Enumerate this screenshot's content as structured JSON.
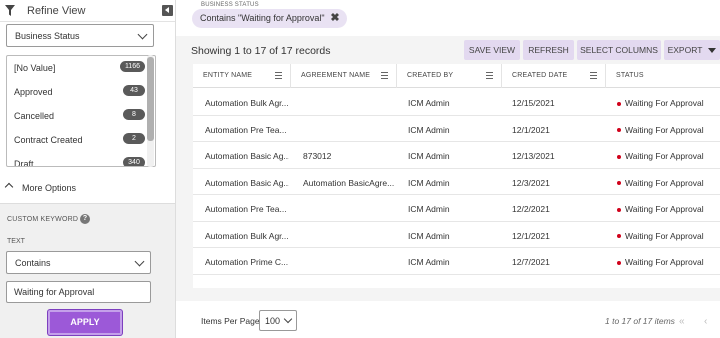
{
  "sidebar": {
    "title": "Refine View",
    "field_select": "Business Status",
    "filter_items": [
      {
        "label": "[No Value]",
        "count": "1166"
      },
      {
        "label": "Approved",
        "count": "43"
      },
      {
        "label": "Cancelled",
        "count": "8"
      },
      {
        "label": "Contract Created",
        "count": "2"
      },
      {
        "label": "Draft",
        "count": "340"
      }
    ],
    "more_options": "More Options",
    "custom_keyword": "CUSTOM KEYWORD",
    "text_label": "TEXT",
    "operator": "Contains",
    "keyword_value": "Waiting for Approval",
    "apply": "APPLY"
  },
  "chip": {
    "caption": "BUSINESS STATUS",
    "label": "Contains \"Waiting for Approval\"",
    "close_glyph": "✖"
  },
  "toolbar": {
    "showing": "Showing 1 to 17 of 17 records",
    "save_view": "SAVE VIEW",
    "refresh": "REFRESH",
    "select_columns": "SELECT COLUMNS",
    "export": "EXPORT"
  },
  "table": {
    "columns": [
      "ENTITY NAME",
      "AGREEMENT NAME",
      "CREATED BY",
      "CREATED DATE",
      "STATUS"
    ],
    "rows": [
      [
        "Automation Bulk Agr...",
        "",
        "ICM Admin",
        "12/15/2021",
        "Waiting For Approval"
      ],
      [
        "Automation Pre Tea...",
        "",
        "ICM Admin",
        "12/1/2021",
        "Waiting For Approval"
      ],
      [
        "Automation Basic Ag...",
        "873012",
        "ICM Admin",
        "12/13/2021",
        "Waiting For Approval"
      ],
      [
        "Automation Basic Ag...",
        "Automation BasicAgre...",
        "ICM Admin",
        "12/3/2021",
        "Waiting For Approval"
      ],
      [
        "Automation Pre Tea...",
        "",
        "ICM Admin",
        "12/2/2021",
        "Waiting For Approval"
      ],
      [
        "Automation Bulk Agr...",
        "",
        "ICM Admin",
        "12/1/2021",
        "Waiting For Approval"
      ],
      [
        "Automation Prime C...",
        "",
        "ICM Admin",
        "12/7/2021",
        "Waiting For Approval"
      ]
    ]
  },
  "footer": {
    "items_per_page_label": "Items Per Page",
    "items_per_page": "100",
    "range": "1 to 17 of 17 items",
    "first_glyph": "«",
    "prev_glyph": "‹"
  },
  "colors": {
    "accent": "#9c59d8",
    "chip_bg": "#e9e2f3",
    "button_bg": "#e3d9f0",
    "status_dot": "#d0021b"
  }
}
